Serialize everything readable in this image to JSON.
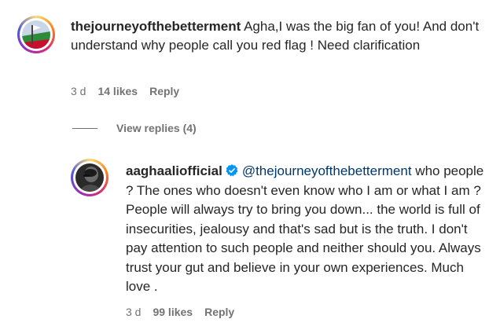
{
  "comments": [
    {
      "username": "thejourneyofthebetterment",
      "text": "Agha,I was the big fan of you! And don't understand why people call you red flag ! Need clarification",
      "time": "3 d",
      "likes": "14 likes",
      "reply": "Reply"
    }
  ],
  "view_replies": "View replies (4)",
  "reply_comment": {
    "username": "aaghaaliofficial",
    "mention": "@thejourneyofthebetterment",
    "text": " who people ? The ones who doesn't even know who I am or what I am ? People will always try to bring you down... the world is full of insecurities, jealousy and that's sad but is the truth. I don't pay attention to such people and neither should you. Always trust your gut and believe in your own experiences. Much love .",
    "time": "3 d",
    "likes": "99 likes",
    "reply": "Reply"
  },
  "colors": {
    "verified": "#0095f6",
    "mention": "#00376b",
    "meta": "#737373"
  }
}
